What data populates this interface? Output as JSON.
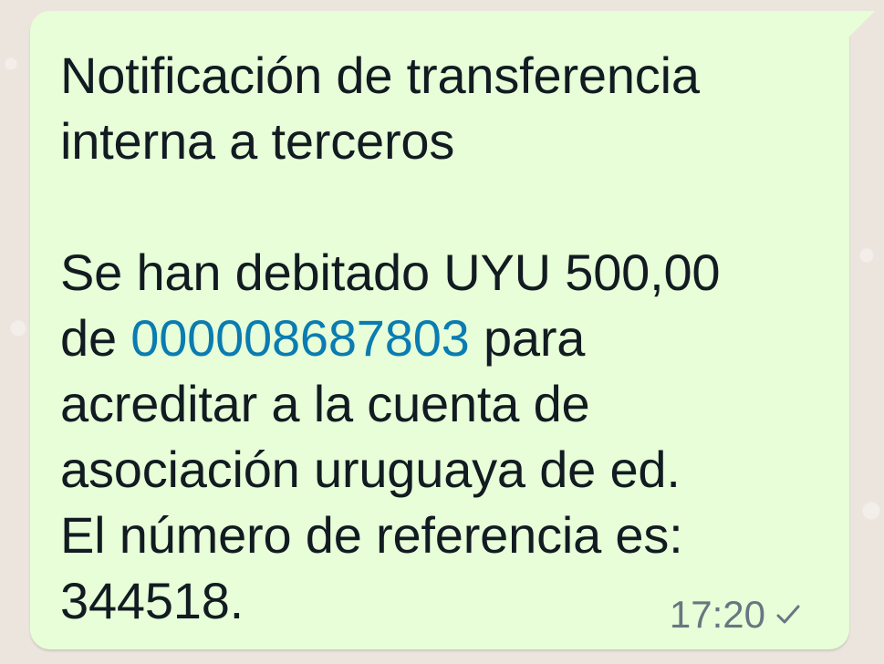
{
  "message": {
    "title_line_1": "Notificación de transferencia",
    "title_line_2": "interna a terceros",
    "body_line_1": "Se han debitado UYU 500,00",
    "body_line_2_prefix": "de ",
    "account_number": "000008687803",
    "body_line_2_suffix": " para",
    "body_line_3": "acreditar a la cuenta de",
    "body_line_4": "asociación uruguaya de ed.",
    "body_line_5": "El número de referencia es:",
    "reference_number": "344518."
  },
  "meta": {
    "time": "17:20",
    "status_icon": "single-check-icon"
  },
  "colors": {
    "bubble": "#e7fed8",
    "background": "#ece5dd",
    "text": "#111b21",
    "link": "#0a7cb1",
    "meta": "#667781"
  }
}
